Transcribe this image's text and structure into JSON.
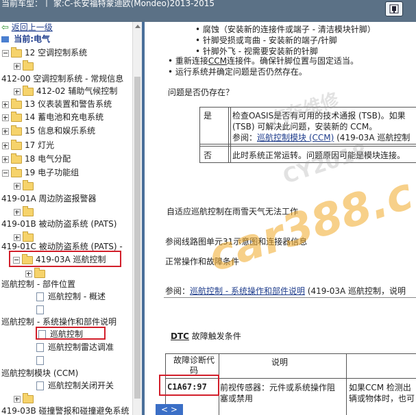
{
  "title_bar": {
    "text": "当前车型：丨 家:C-长安福特蒙迪欧(Mondeo)2013-2015"
  },
  "sidebar": {
    "back_link": "返回上一级",
    "current_label": "当前:电气",
    "items": [
      "12 空调控制系统",
      "412-00 空调控制系统 - 常规信息",
      "412-02 辅助气候控制",
      "13 仪表装置和警告系统",
      "14 蓄电池和充电系统",
      "15 信息和娱乐系统",
      "17 灯光",
      "18 电气分配",
      "19 电子功能组",
      "419-01A 周边防盗报警器",
      "419-01B 被动防盗系统 (PATS)",
      "419-01C 被动防盗系统 (PATS) -",
      "419-03A 巡航控制",
      "巡航控制 - 部件位置",
      "巡航控制 - 概述",
      "巡航控制 - 系统操作和部件说明",
      "巡航控制",
      "巡航控制雷达调准",
      "巡航控制模块 (CCM)",
      "巡航控制关闭开关",
      "419-03B 碰撞警报和碰撞避免系统"
    ]
  },
  "content": {
    "bullets_sub": [
      "腐蚀（安装新的连接件或端子 - 清洁模块针脚）",
      "针脚受损或弯曲 - 安装新的端子/针脚",
      "针脚外飞 - 视需要安装新的针脚"
    ],
    "bullets": [
      [
        "重新连接",
        "CCM",
        "连接件。确保针脚位置与固定适当。"
      ],
      [
        "运行系统并确定问题是否仍然存在。"
      ]
    ],
    "question": "问题是否仍存在？",
    "qtable": {
      "yes": "是",
      "yes_line1": "检查OASIS是否有可用的技术通报 (TSB)。如果",
      "yes_line2": "(TSB) 可解决此问题，安装新的 CCM。",
      "yes_line3_pre": "参阅：",
      "yes_line3_link": "巡航控制模块 (CCM)",
      "yes_line3_post": " (419-03A 巡航控制",
      "no": "否",
      "no_text": "此时系统正常运转。问题原因可能是模块连接。"
    },
    "section_title": "自适应巡航控制在雨雪天气无法工作",
    "ref_wiring": "参阅线路图单元31示意图和连接器信息",
    "normal_cond": "正常操作和故障条件",
    "ref_pre": "参阅：",
    "ref_link": "巡航控制 - 系统操作和部件说明",
    "ref_post": " (419-03A 巡航控制，说明",
    "dtc_heading_a": "DTC",
    "dtc_heading_b": " 故障触发条件",
    "dtc_table": {
      "col1": "故障诊断代码",
      "col2": "说明",
      "code": "C1A67:97",
      "desc1": "前视传感器：元件或系统操作阻",
      "desc2": "塞或禁用",
      "cond1": "如果CCM 检测出",
      "cond2": "辆或物体时，也可"
    },
    "nav_button": "< >",
    "watermarks": [
      "汽车维修",
      "car388.c",
      "CY2018"
    ]
  },
  "colors": {
    "titlebar": "#5b7186",
    "divider": "#4a6f9a",
    "link": "#1f3d8c",
    "highlight": "#d21e2a",
    "folder": "#f6d36b"
  }
}
